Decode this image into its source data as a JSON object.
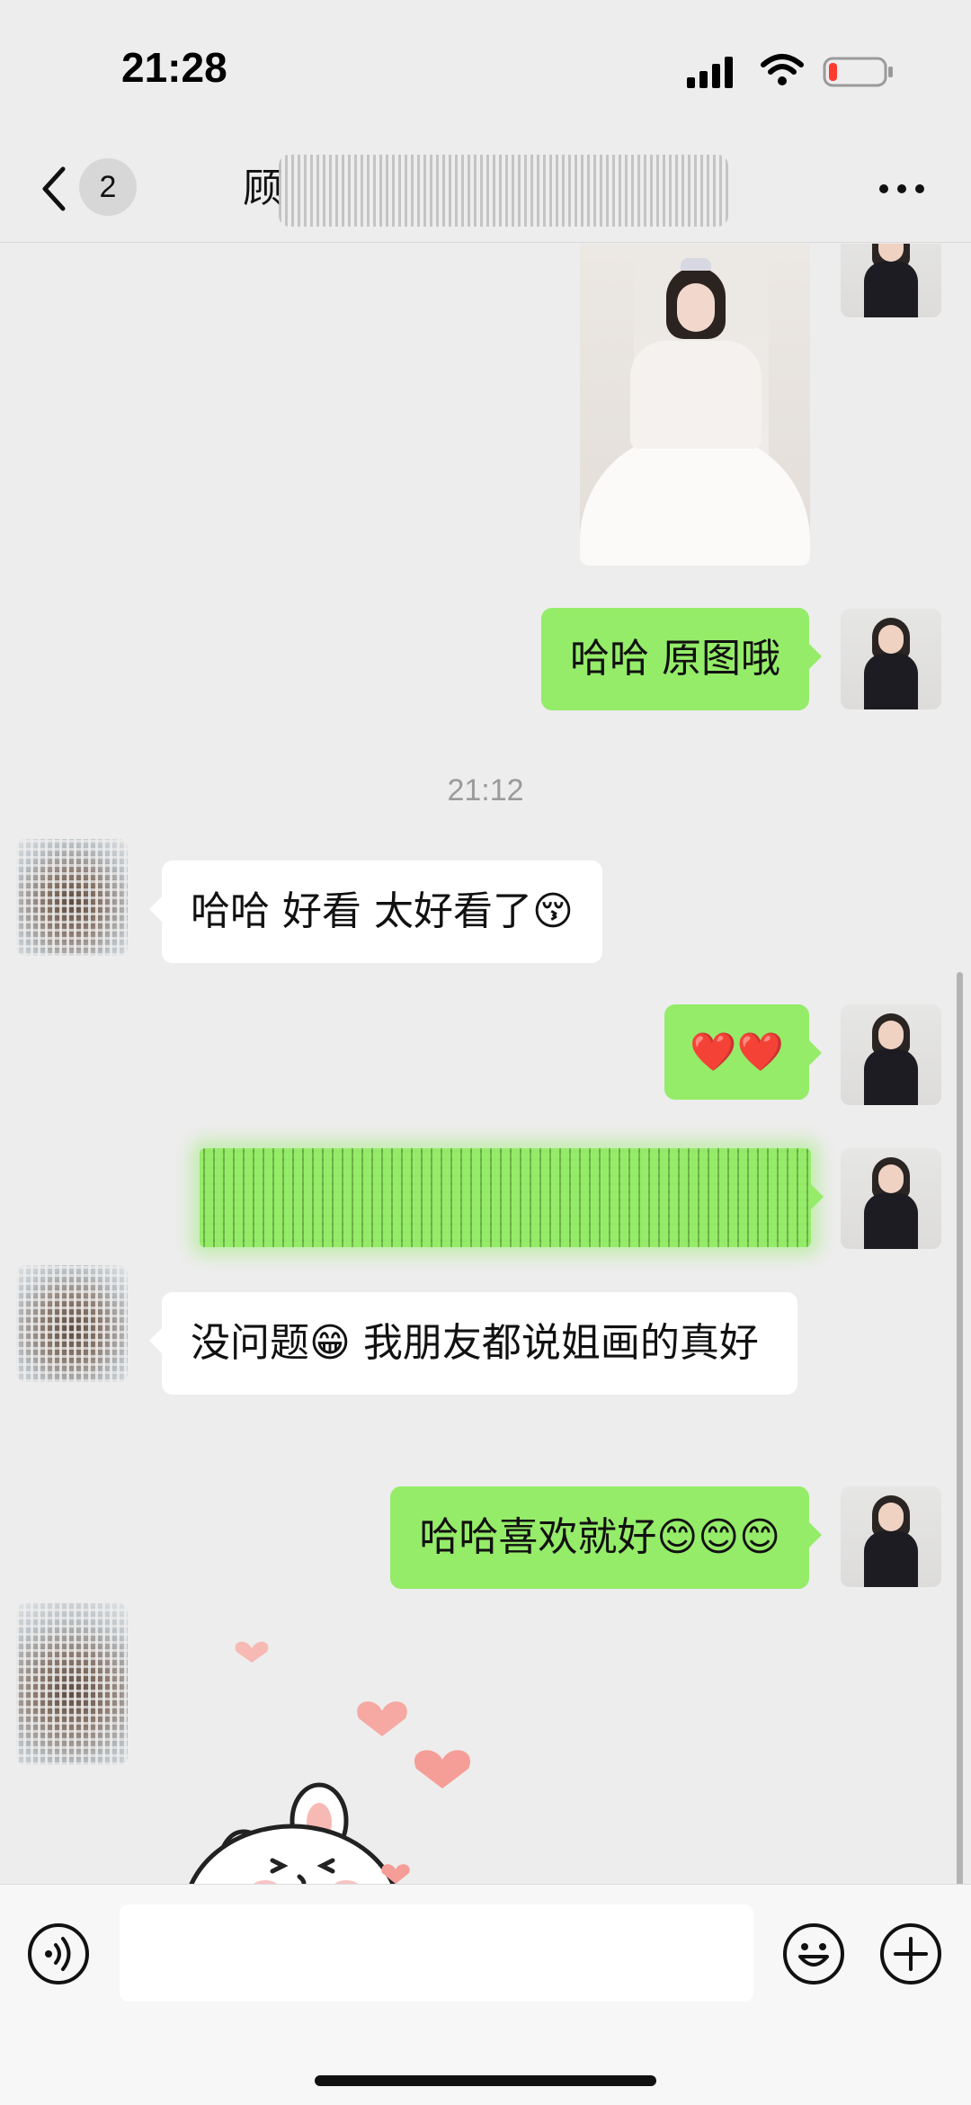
{
  "status_bar": {
    "time": "21:28",
    "battery_level_fraction": 0.12,
    "battery_color": "#ff3b30"
  },
  "nav": {
    "unread_count": "2",
    "title_visible": "顾",
    "icons": [
      "back-chevron-icon",
      "more-dots-icon"
    ]
  },
  "chat": {
    "messages": [
      {
        "side": "self",
        "kind": "image"
      },
      {
        "side": "self",
        "kind": "text",
        "text": "哈哈 原图哦"
      },
      {
        "kind": "timestamp",
        "text": "21:12"
      },
      {
        "side": "other",
        "kind": "text",
        "text": "哈哈 好看 太好看了😚"
      },
      {
        "side": "self",
        "kind": "text",
        "text": "❤️❤️"
      },
      {
        "side": "self",
        "kind": "text",
        "text": "",
        "redacted": true
      },
      {
        "side": "other",
        "kind": "text",
        "text": "没问题😁 我朋友都说姐画的真好"
      },
      {
        "side": "self",
        "kind": "text",
        "text": "哈哈喜欢就好😊😊😊"
      },
      {
        "side": "other",
        "kind": "sticker"
      }
    ],
    "colors": {
      "outgoing_bubble": "#95ec69",
      "incoming_bubble": "#ffffff",
      "background": "#ededed"
    }
  },
  "input_bar": {
    "placeholder": "",
    "icons": [
      "voice-icon",
      "emoji-icon",
      "plus-icon"
    ]
  }
}
